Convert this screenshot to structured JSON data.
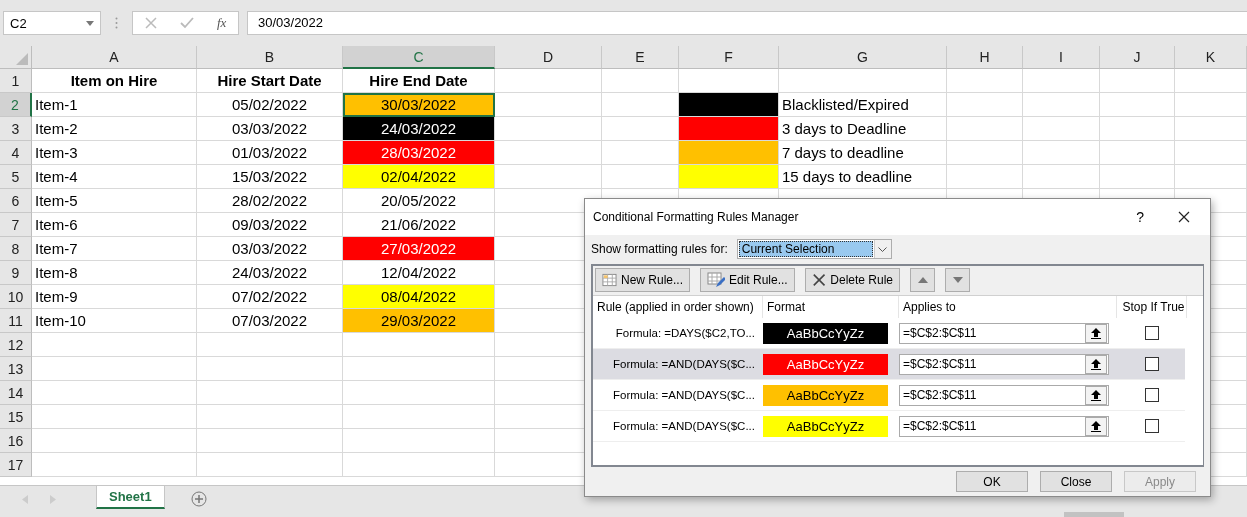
{
  "formula_bar": {
    "name_box": "C2",
    "function_label": "fx",
    "value": "30/03/2022"
  },
  "sheet": {
    "columns": [
      {
        "label": "A",
        "selected": false
      },
      {
        "label": "B",
        "selected": false
      },
      {
        "label": "C",
        "selected": true
      },
      {
        "label": "D",
        "selected": false
      },
      {
        "label": "E",
        "selected": false
      },
      {
        "label": "F",
        "selected": false
      },
      {
        "label": "G",
        "selected": false
      },
      {
        "label": "H",
        "selected": false
      },
      {
        "label": "I",
        "selected": false
      },
      {
        "label": "J",
        "selected": false
      },
      {
        "label": "K",
        "selected": false
      }
    ],
    "rows": [
      {
        "label": "1",
        "selected": false,
        "kind": "header",
        "cells": [
          {
            "text": "Item on Hire"
          },
          {
            "text": "Hire Start Date"
          },
          {
            "text": "Hire End Date"
          }
        ]
      },
      {
        "label": "2",
        "selected": true,
        "cells": [
          {
            "text": "Item-1"
          },
          {
            "text": "05/02/2022"
          },
          {
            "text": "30/03/2022",
            "color": "#ffc000"
          },
          {},
          {},
          {
            "color": "#000000"
          },
          {
            "text": "Blacklisted/Expired"
          }
        ]
      },
      {
        "label": "3",
        "selected": false,
        "cells": [
          {
            "text": "Item-2"
          },
          {
            "text": "03/03/2022"
          },
          {
            "text": "24/03/2022",
            "color": "#000000"
          },
          {},
          {},
          {
            "color": "#ff0000"
          },
          {
            "text": "3 days to Deadline"
          }
        ]
      },
      {
        "label": "4",
        "selected": false,
        "cells": [
          {
            "text": "Item-3"
          },
          {
            "text": "01/03/2022"
          },
          {
            "text": "28/03/2022",
            "color": "#ff0000"
          },
          {},
          {},
          {
            "color": "#ffc000"
          },
          {
            "text": "7 days to deadline"
          }
        ]
      },
      {
        "label": "5",
        "selected": false,
        "cells": [
          {
            "text": "Item-4"
          },
          {
            "text": "15/03/2022"
          },
          {
            "text": "02/04/2022",
            "color": "#ffff00"
          },
          {},
          {},
          {
            "color": "#ffff00"
          },
          {
            "text": "15 days to deadline"
          }
        ]
      },
      {
        "label": "6",
        "selected": false,
        "cells": [
          {
            "text": "Item-5"
          },
          {
            "text": "28/02/2022"
          },
          {
            "text": "20/05/2022"
          }
        ]
      },
      {
        "label": "7",
        "selected": false,
        "cells": [
          {
            "text": "Item-6"
          },
          {
            "text": "09/03/2022"
          },
          {
            "text": "21/06/2022"
          }
        ]
      },
      {
        "label": "8",
        "selected": false,
        "cells": [
          {
            "text": "Item-7"
          },
          {
            "text": "03/03/2022"
          },
          {
            "text": "27/03/2022",
            "color": "#ff0000"
          }
        ]
      },
      {
        "label": "9",
        "selected": false,
        "cells": [
          {
            "text": "Item-8"
          },
          {
            "text": "24/03/2022"
          },
          {
            "text": "12/04/2022"
          }
        ]
      },
      {
        "label": "10",
        "selected": false,
        "cells": [
          {
            "text": "Item-9"
          },
          {
            "text": "07/02/2022"
          },
          {
            "text": "08/04/2022",
            "color": "#ffff00"
          }
        ]
      },
      {
        "label": "11",
        "selected": false,
        "cells": [
          {
            "text": "Item-10"
          },
          {
            "text": "07/03/2022"
          },
          {
            "text": "29/03/2022",
            "color": "#ffc000"
          }
        ]
      },
      {
        "label": "12",
        "selected": false,
        "cells": []
      },
      {
        "label": "13",
        "selected": false,
        "cells": []
      },
      {
        "label": "14",
        "selected": false,
        "cells": []
      },
      {
        "label": "15",
        "selected": false,
        "cells": []
      },
      {
        "label": "16",
        "selected": false,
        "cells": []
      },
      {
        "label": "17",
        "selected": false,
        "cells": []
      }
    ]
  },
  "tabs": [
    {
      "label": "Sheet1",
      "selected": true
    }
  ],
  "dialog": {
    "title": "Conditional Formatting Rules Manager",
    "help": "?",
    "show_label": "Show formatting rules for:",
    "scope": "Current Selection",
    "toolbar": [
      {
        "kind": "new",
        "label": "New Rule..."
      },
      {
        "kind": "edit",
        "label": "Edit Rule..."
      },
      {
        "kind": "delete",
        "label": "Delete Rule"
      },
      {
        "kind": "up"
      },
      {
        "kind": "down"
      }
    ],
    "columns": [
      "Rule (applied in order shown)",
      "Format",
      "Applies to",
      "Stop If True"
    ],
    "rules": [
      {
        "rule": "Formula: =DAYS($C2,TO...",
        "preview": "AaBbCcYyZz",
        "color": "#000000",
        "applies_to": "=$C$2:$C$11",
        "stop_if_true": false,
        "selected": false
      },
      {
        "rule": "Formula: =AND(DAYS($C...",
        "preview": "AaBbCcYyZz",
        "color": "#ff0000",
        "applies_to": "=$C$2:$C$11",
        "stop_if_true": false,
        "selected": true
      },
      {
        "rule": "Formula: =AND(DAYS($C...",
        "preview": "AaBbCcYyZz",
        "color": "#ffc000",
        "applies_to": "=$C$2:$C$11",
        "stop_if_true": false,
        "selected": false
      },
      {
        "rule": "Formula: =AND(DAYS($C...",
        "preview": "AaBbCcYyZz",
        "color": "#ffff00",
        "applies_to": "=$C$2:$C$11",
        "stop_if_true": false,
        "selected": false
      }
    ],
    "buttons": [
      {
        "label": "OK",
        "disabled": false
      },
      {
        "label": "Close",
        "disabled": false
      },
      {
        "label": "Apply",
        "disabled": true
      }
    ]
  }
}
